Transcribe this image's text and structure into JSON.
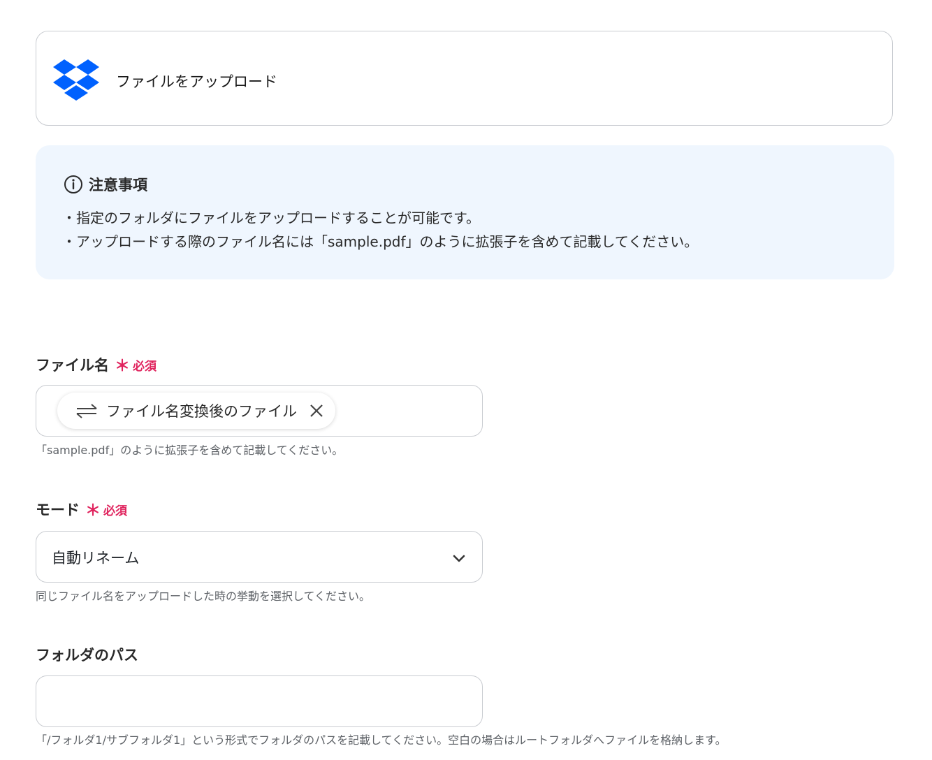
{
  "header": {
    "logo_icon": "dropbox-icon",
    "title": "ファイルをアップロード",
    "brand_color": "#0061fe"
  },
  "notice": {
    "icon": "info-icon",
    "heading": "注意事項",
    "lines": [
      "・指定のフォルダにファイルをアップロードすることが可能です。",
      "・アップロードする際のファイル名には「sample.pdf」のように拡張子を含めて記載してください。"
    ],
    "background": "#eff6fe"
  },
  "fields": {
    "filename": {
      "label": "ファイル名",
      "required_mark": "＊",
      "required_text": "必須",
      "chip": {
        "icon": "swap-arrows-icon",
        "text": "ファイル名変換後のファイル",
        "remove_icon": "close-icon"
      },
      "help": "「sample.pdf」のように拡張子を含めて記載してください。"
    },
    "mode": {
      "label": "モード",
      "required_mark": "＊",
      "required_text": "必須",
      "selected": "自動リネーム",
      "chevron_icon": "chevron-down-icon",
      "help": "同じファイル名をアップロードした時の挙動を選択してください。"
    },
    "folder_path": {
      "label": "フォルダのパス",
      "value": "",
      "help": "「/フォルダ1/サブフォルダ1」という形式でフォルダのパスを記載してください。空白の場合はルートフォルダへファイルを格納します。"
    }
  },
  "colors": {
    "required": "#e0245e",
    "border": "#c9ccd1",
    "help_text": "#5f6368"
  }
}
